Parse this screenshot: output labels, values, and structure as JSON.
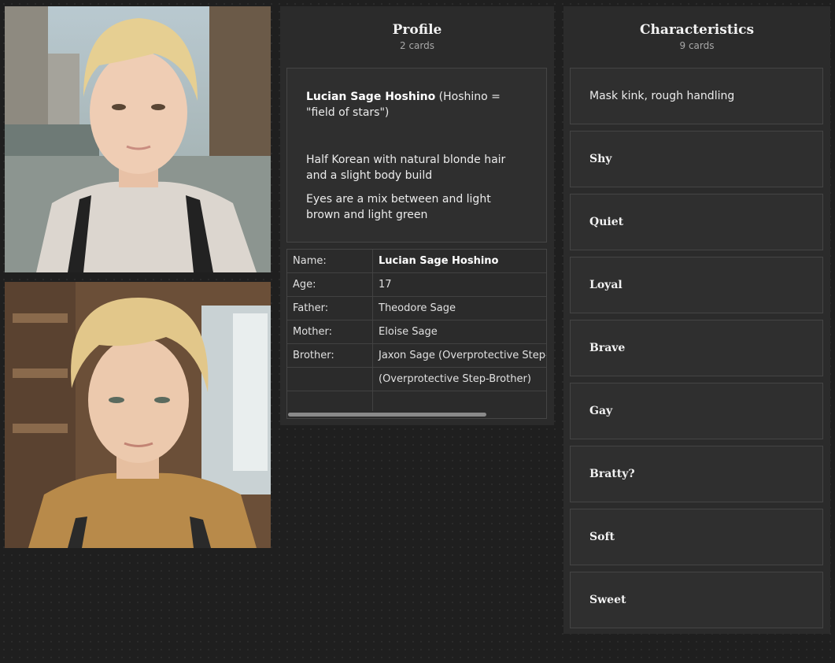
{
  "profile": {
    "title": "Profile",
    "count": "2 cards",
    "bio": {
      "name": "Lucian Sage Hoshino",
      "name_note": " (Hoshino = \"field of stars\")",
      "desc": "Half Korean with natural blonde hair and a slight body build",
      "eyes": "Eyes are a mix between and light brown and light green"
    },
    "table": [
      {
        "key": "Name:",
        "value": "Lucian Sage Hoshino"
      },
      {
        "key": "Age:",
        "value": "17"
      },
      {
        "key": "Father:",
        "value": "Theodore Sage"
      },
      {
        "key": "Mother:",
        "value": "Eloise Sage"
      },
      {
        "key": "Brother:",
        "value": "Jaxon Sage (Overprotective Step-Brother)"
      },
      {
        "key": "",
        "value": "(Overprotective Step-Brother)"
      },
      {
        "key": "",
        "value": ""
      }
    ]
  },
  "characteristics": {
    "title": "Characteristics",
    "count": "9 cards",
    "items": [
      "Mask kink, rough handling",
      "Shy",
      "Quiet",
      "Loyal",
      "Brave",
      "Gay",
      "Bratty?",
      "Soft",
      "Sweet"
    ]
  }
}
